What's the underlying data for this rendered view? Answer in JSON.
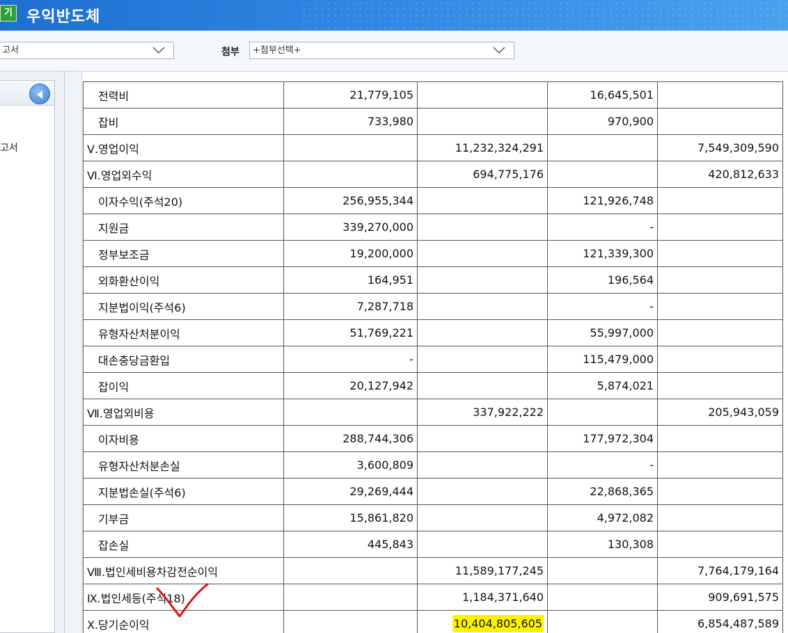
{
  "window": {
    "app_badge": "기",
    "title": "우익반도체"
  },
  "toolbar": {
    "report_select_value": "고서",
    "attach_label": "첨부",
    "attach_select_value": "+첨부선택+"
  },
  "sidebar": {
    "items": [
      {
        "label": "고서"
      }
    ]
  },
  "table": {
    "rows": [
      {
        "label": "전력비",
        "indent": true,
        "c1": "21,779,105",
        "c2": "",
        "c3": "16,645,501",
        "c4": ""
      },
      {
        "label": "잡비",
        "indent": true,
        "c1": "733,980",
        "c2": "",
        "c3": "970,900",
        "c4": ""
      },
      {
        "label": "Ⅴ.영업이익",
        "indent": false,
        "c1": "",
        "c2": "11,232,324,291",
        "c3": "",
        "c4": "7,549,309,590"
      },
      {
        "label": "Ⅵ.영업외수익",
        "indent": false,
        "c1": "",
        "c2": "694,775,176",
        "c3": "",
        "c4": "420,812,633"
      },
      {
        "label": "이자수익(주석20)",
        "indent": true,
        "c1": "256,955,344",
        "c2": "",
        "c3": "121,926,748",
        "c4": ""
      },
      {
        "label": "지원금",
        "indent": true,
        "c1": "339,270,000",
        "c2": "",
        "c3": "-",
        "c4": ""
      },
      {
        "label": "정부보조금",
        "indent": true,
        "c1": "19,200,000",
        "c2": "",
        "c3": "121,339,300",
        "c4": ""
      },
      {
        "label": "외화환산이익",
        "indent": true,
        "c1": "164,951",
        "c2": "",
        "c3": "196,564",
        "c4": ""
      },
      {
        "label": "지분법이익(주석6)",
        "indent": true,
        "c1": "7,287,718",
        "c2": "",
        "c3": "-",
        "c4": ""
      },
      {
        "label": "유형자산처분이익",
        "indent": true,
        "c1": "51,769,221",
        "c2": "",
        "c3": "55,997,000",
        "c4": ""
      },
      {
        "label": "대손충당금환입",
        "indent": true,
        "c1": "-",
        "c2": "",
        "c3": "115,479,000",
        "c4": ""
      },
      {
        "label": "잡이익",
        "indent": true,
        "c1": "20,127,942",
        "c2": "",
        "c3": "5,874,021",
        "c4": ""
      },
      {
        "label": "Ⅶ.영업외비용",
        "indent": false,
        "c1": "",
        "c2": "337,922,222",
        "c3": "",
        "c4": "205,943,059"
      },
      {
        "label": "이자비용",
        "indent": true,
        "c1": "288,744,306",
        "c2": "",
        "c3": "177,972,304",
        "c4": ""
      },
      {
        "label": "유형자산처분손실",
        "indent": true,
        "c1": "3,600,809",
        "c2": "",
        "c3": "-",
        "c4": ""
      },
      {
        "label": "지분법손실(주석6)",
        "indent": true,
        "c1": "29,269,444",
        "c2": "",
        "c3": "22,868,365",
        "c4": ""
      },
      {
        "label": "기부금",
        "indent": true,
        "c1": "15,861,820",
        "c2": "",
        "c3": "4,972,082",
        "c4": ""
      },
      {
        "label": "잡손실",
        "indent": true,
        "c1": "445,843",
        "c2": "",
        "c3": "130,308",
        "c4": ""
      },
      {
        "label": "Ⅷ.법인세비용차감전순이익",
        "indent": false,
        "c1": "",
        "c2": "11,589,177,245",
        "c3": "",
        "c4": "7,764,179,164"
      },
      {
        "label": "Ⅸ.법인세등(주석18)",
        "indent": false,
        "c1": "",
        "c2": "1,184,371,640",
        "c3": "",
        "c4": "909,691,575"
      },
      {
        "label": "Ⅹ.당기순이익",
        "indent": false,
        "c1": "",
        "c2": "10,404,805,605",
        "c3": "",
        "c4": "6,854,487,589",
        "highlight_c2": true
      }
    ]
  },
  "colors": {
    "title_bar": "#2f86e3",
    "highlight": "#fff200",
    "checkmark": "#e01010"
  }
}
